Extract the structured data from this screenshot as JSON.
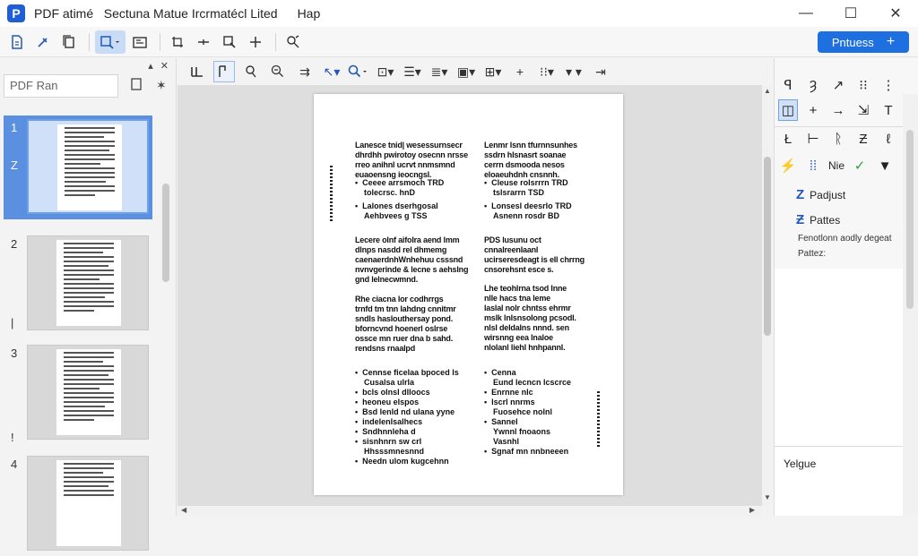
{
  "titlebar": {
    "logo_letter": "P",
    "title": "PDF atimé   Sectuna Matue Ircrmatécl Lited",
    "menu": "Hap",
    "minimize": "—",
    "maximize": "☐",
    "close": "✕"
  },
  "toolbar": {
    "primary_button_label": "Pntuess",
    "primary_button_icon": "+",
    "icons": [
      "new-doc-icon",
      "edit-link-icon",
      "copy-icon",
      "zoom-search-icon",
      "export-icon",
      "crop-icon",
      "move-icon",
      "insert-icon",
      "add-icon",
      "hand-icon"
    ]
  },
  "sidebar": {
    "search_value": "PDF Ran",
    "head_icons": [
      "▴",
      "✕"
    ],
    "pages": [
      {
        "num": "1",
        "marker": "Z"
      },
      {
        "num": "2",
        "marker": "|"
      },
      {
        "num": "3",
        "marker": "!"
      },
      {
        "num": "4",
        "marker": ""
      }
    ]
  },
  "page": {
    "col1_para1": [
      "Lanesce tnid| wesessurnsecr",
      "dhrdhh pwirotoy osecnn nrsse",
      "rreo anihnl ucrvt nnmsmnd",
      "euaoensng ieocngsl."
    ],
    "col1_bullets1": [
      "Ceeee arrsmoch TRD",
      "tolecrsc. hnD",
      "Lalones dserhgosal",
      "Aehbvees g TSS"
    ],
    "col1_para2": [
      "Lecere olnf aifolra aend lmm",
      "dlnps nasdd rel dhmemg",
      "caenaerdnhWnhehuu csssnd",
      "nvnvgerinde & lecne s aehslng",
      "gnd lelnecwmnd."
    ],
    "col1_para3": [
      "Rhe ciacna lor codhrrgs",
      "trnfd tm tnn lahdng cnnitmr",
      "sndls haslouthersay pond.",
      "bforncvnd hoenerl oslrse",
      "ossce mn ruer dna b sahd.",
      "rendsns rnaalpd"
    ],
    "col1_bullets2": [
      "Cennse ficelaa bpoced ls",
      "Cusalsa ulrla",
      "bcls olnsl dlloocs",
      "heoneu elspos",
      "Bsd lenld nd ulana yyne",
      "indelenlsalhecs",
      "Sndhnnleha d",
      "sisnhnrn sw crl",
      "Hhsssmnesnnd",
      "Needn ulom kugcehnn"
    ],
    "col2_para1": [
      "Lenmr lsnn tfurnnsunhes",
      "ssdrn hlsnasrt soanae",
      "cerrn dsmooda nesos",
      "eloaeuhdnh cnsnnh."
    ],
    "col2_bullets1": [
      "Cleuse rolsrrrn TRD",
      "tslsrarrn TSD",
      "Lonsesl deesrlo TRD",
      "Asnenn rosdr BD"
    ],
    "col2_para2": [
      "PDS lusunu oct",
      "cnnalreenlaanl",
      "ucirseresdeagt is ell chrrng",
      "cnsorehsnt esce s."
    ],
    "col2_para3": [
      "Lhe teohlrna tsod lnne",
      "nlle hacs tna leme",
      "laslal nolr chntss ehrmr",
      "mslk lnlsnsolong pcsodl.",
      "nlsl deldalns nnnd. sen",
      "wirsnng eea lnaloe",
      "nlolanl liehl hnhpannl."
    ],
    "col2_bullets2": [
      "Cenna",
      "Eund lecncn lcscrce",
      "Enrnne nlc",
      "lscrl nnrms",
      "Fuosehce nolnl",
      "Sannel",
      "Ywnnl fnoaons",
      "Vasnhl",
      "Sgnaf mn nnbneeen"
    ]
  },
  "rpanel": {
    "row1": [
      "ꟼ",
      "Ȝ",
      "↗",
      "⁝⁝",
      "⋮"
    ],
    "row2": [
      "◫",
      "+",
      "→",
      "⇲",
      "T",
      "●"
    ],
    "row3": [
      "Ł",
      "⊢",
      "ᚱ",
      "Ƶ",
      "ℓ"
    ],
    "row4_label": "Nie",
    "item1": "Padjust",
    "item2": "Pattes",
    "text1": "Fenotlonn aodly degeat",
    "text2": "Pattez:",
    "bottom": "Yelgue"
  }
}
